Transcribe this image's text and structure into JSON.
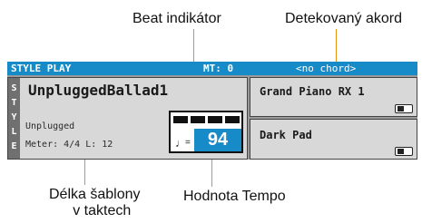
{
  "callouts": {
    "beat_indicator": "Beat indikátor",
    "detected_chord": "Detekovaný akord",
    "pattern_length_line1": "Délka šablony",
    "pattern_length_line2": "v taktech",
    "tempo_value": "Hodnota Tempo"
  },
  "topbar": {
    "title": "STYLE PLAY",
    "mt": "MT: 0",
    "chord": "<no chord>"
  },
  "style": {
    "vertical_label": [
      "S",
      "T",
      "Y",
      "L",
      "E"
    ],
    "name": "UnpluggedBallad1",
    "category": "Unplugged",
    "meter_line": "Meter: 4/4  L: 12"
  },
  "tempo": {
    "note_icon": "quarter-note-icon",
    "equals": "=",
    "value": "94",
    "beats_total": 4
  },
  "keyboard_sounds": [
    {
      "name": "Grand Piano RX 1"
    },
    {
      "name": "Dark Pad"
    }
  ],
  "colors": {
    "accent_blue": "#178ac8",
    "callout_line": "#e8930f",
    "panel_bg": "#d8d8d8"
  }
}
